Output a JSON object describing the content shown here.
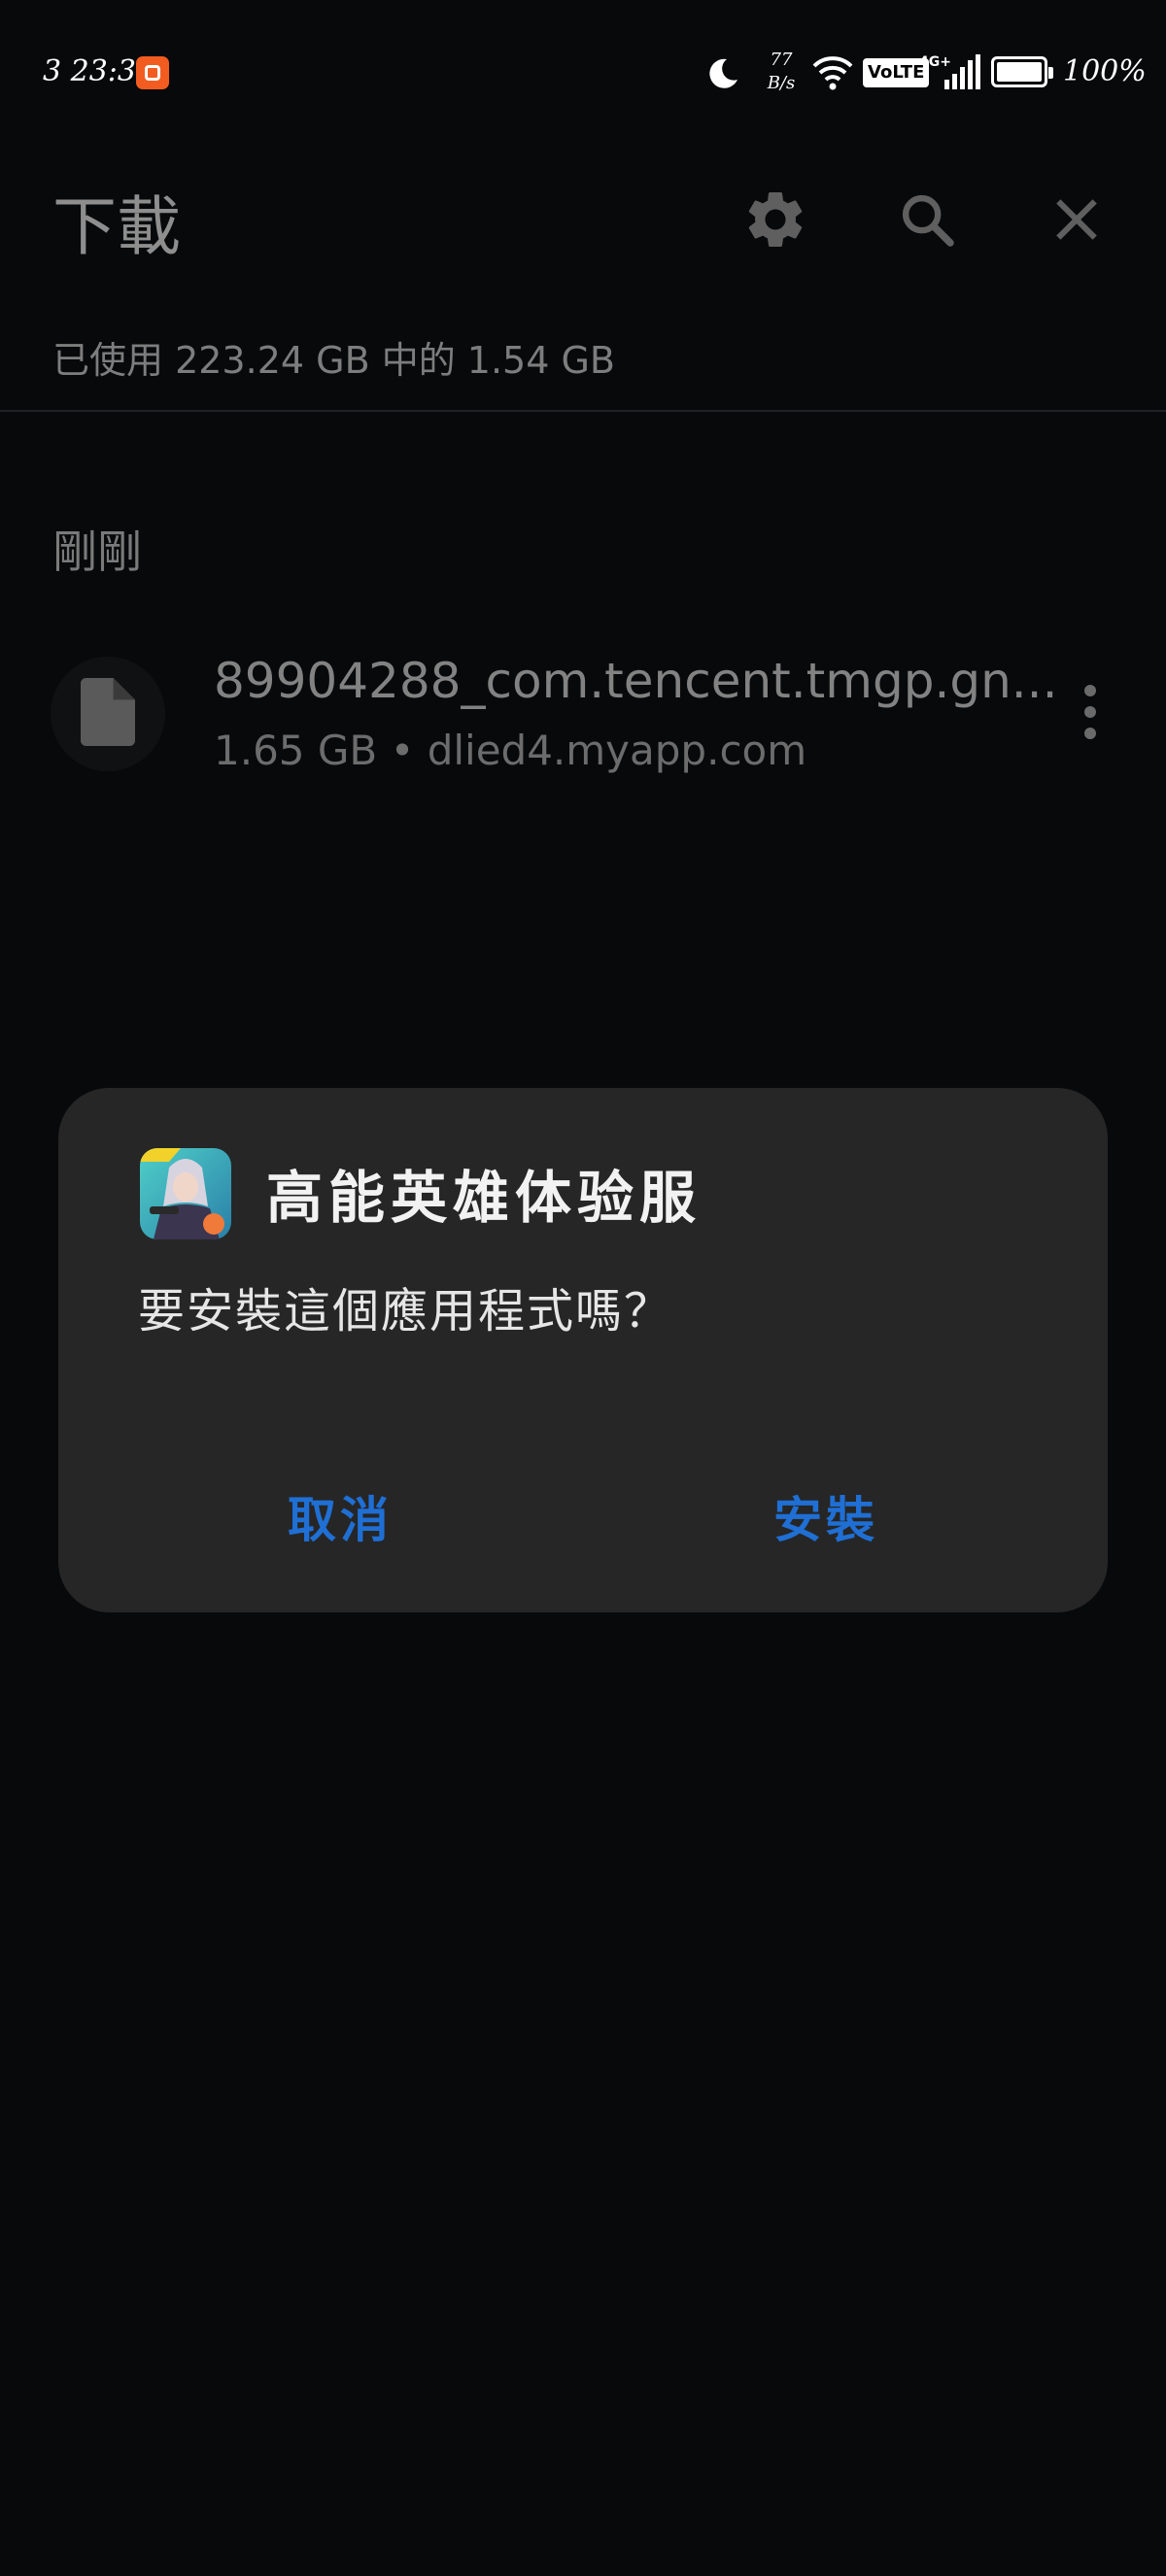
{
  "status_bar": {
    "time": "3 23:37",
    "network_speed_value": "77",
    "network_speed_unit": "B/s",
    "volte": "VoLTE",
    "network": "4G+",
    "battery_text": "100%",
    "battery_level": 1.0
  },
  "header": {
    "title": "下載",
    "icons": [
      "gear-icon",
      "search-icon",
      "close-icon"
    ]
  },
  "storage": {
    "info": "已使用 223.24 GB 中的 1.54 GB"
  },
  "section": {
    "label": "剛剛"
  },
  "downloads": [
    {
      "name": "89904288_com.tencent.tmgp.gn...",
      "meta": "1.65 GB • dlied4.myapp.com",
      "icon": "file-icon"
    }
  ],
  "dialog": {
    "app_name": "高能英雄体验服",
    "message": "要安裝這個應用程式嗎？",
    "cancel_label": "取消",
    "install_label": "安裝"
  },
  "colors": {
    "background": "#08090b",
    "dialog": "#262626",
    "accent": "#1f6fd4"
  }
}
